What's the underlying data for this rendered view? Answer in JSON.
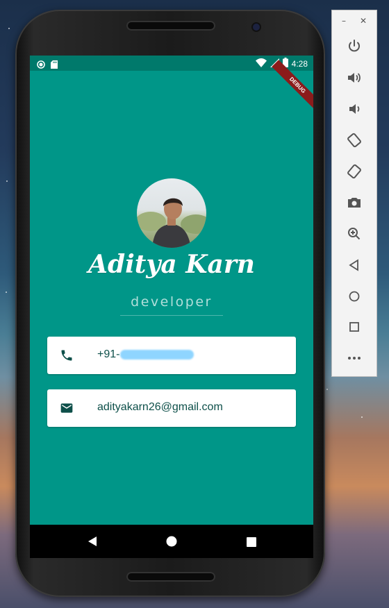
{
  "status_bar": {
    "time": "4:28"
  },
  "debug_banner": "DEBUG",
  "profile": {
    "name": "Aditya Karn",
    "role": "developer"
  },
  "contacts": {
    "phone_prefix": "+91-",
    "email": "adityakarn26@gmail.com"
  },
  "colors": {
    "app_background": "#009688",
    "status_bar": "#00796B",
    "card_text": "#0D4F49",
    "role_text": "#B2DFDB",
    "blur_redaction": "#8FD5FF"
  },
  "icons": {
    "status_bar": [
      "record-icon",
      "sd-card-icon",
      "wifi-icon",
      "signal-icon",
      "battery-icon"
    ],
    "cards": [
      "phone-icon",
      "mail-icon"
    ],
    "navigation": [
      "back-icon",
      "home-icon",
      "recents-icon"
    ],
    "emulator_toolbar": [
      "minimize-icon",
      "close-icon",
      "power-icon",
      "volume-up-icon",
      "volume-down-icon",
      "rotate-left-icon",
      "rotate-right-icon",
      "camera-icon",
      "zoom-icon",
      "back-icon",
      "home-icon",
      "overview-icon",
      "more-icon"
    ]
  }
}
